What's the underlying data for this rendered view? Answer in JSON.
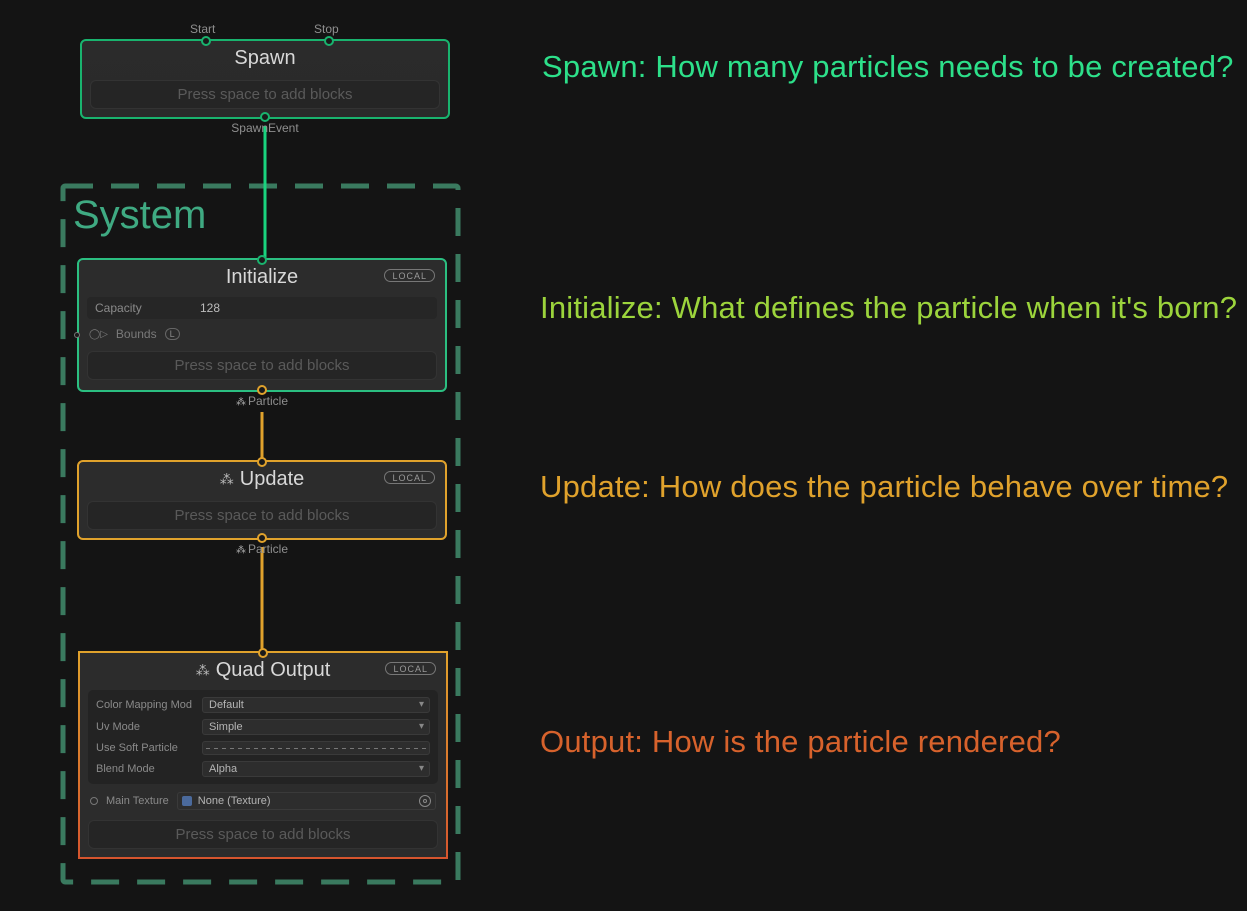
{
  "system_label": "System",
  "spawn": {
    "title": "Spawn",
    "add_blocks": "Press space to add blocks",
    "port_start": "Start",
    "port_stop": "Stop",
    "port_out": "SpawnEvent"
  },
  "initialize": {
    "title": "Initialize",
    "local": "LOCAL",
    "capacity_label": "Capacity",
    "capacity_value": "128",
    "bounds_label": "Bounds",
    "bounds_badge": "L",
    "add_blocks": "Press space to add blocks",
    "port_out": "Particle"
  },
  "update": {
    "title": "Update",
    "local": "LOCAL",
    "add_blocks": "Press space to add blocks",
    "port_out": "Particle"
  },
  "output": {
    "title": "Quad Output",
    "local": "LOCAL",
    "rows": {
      "color_mapping_label": "Color Mapping Mod",
      "color_mapping_value": "Default",
      "uv_mode_label": "Uv Mode",
      "uv_mode_value": "Simple",
      "soft_particle_label": "Use Soft Particle",
      "blend_mode_label": "Blend Mode",
      "blend_mode_value": "Alpha",
      "main_texture_label": "Main Texture",
      "main_texture_value": "None (Texture)"
    },
    "add_blocks": "Press space to add blocks"
  },
  "annotations": {
    "spawn": "Spawn: How many particles needs to be created?",
    "initialize": "Initialize: What defines the particle when it's born?",
    "update": "Update: How does the particle behave over time?",
    "output": "Output: How is the particle rendered?"
  }
}
